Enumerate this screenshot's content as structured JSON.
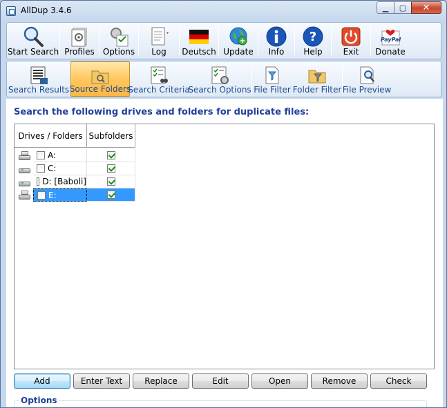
{
  "window": {
    "title": "AllDup 3.4.6",
    "min_glyph": "▁",
    "max_glyph": "▢",
    "close_glyph": "✕"
  },
  "toolbar_main": [
    {
      "label": "Start Search",
      "icon": "magnifier-icon"
    },
    {
      "label": "Profiles",
      "icon": "profiles-icon"
    },
    {
      "label": "Options",
      "icon": "options-icon"
    },
    {
      "label": "Log",
      "icon": "log-icon"
    },
    {
      "label": "Deutsch",
      "icon": "german-flag-icon"
    },
    {
      "label": "Update",
      "icon": "update-globe-icon"
    },
    {
      "label": "Info",
      "icon": "info-icon"
    },
    {
      "label": "Help",
      "icon": "help-icon"
    },
    {
      "label": "Exit",
      "icon": "power-icon"
    },
    {
      "label": "Donate",
      "icon": "paypal-icon"
    }
  ],
  "toolbar_views": [
    {
      "label": "Search Results",
      "active": false
    },
    {
      "label": "Source Folders",
      "active": true
    },
    {
      "label": "Search Criteria",
      "active": false
    },
    {
      "label": "Search Options",
      "active": false
    },
    {
      "label": "File Filter",
      "active": false
    },
    {
      "label": "Folder Filter",
      "active": false
    },
    {
      "label": "File Preview",
      "active": false
    }
  ],
  "main": {
    "heading": "Search the following drives and folders for duplicate files:",
    "columns": [
      "Drives / Folders",
      "Subfolders"
    ],
    "rows": [
      {
        "name": "A:",
        "checked": false,
        "subfolders": true,
        "selected": false
      },
      {
        "name": "C:",
        "checked": false,
        "subfolders": true,
        "selected": false
      },
      {
        "name": "D: [Baboli]",
        "checked": false,
        "subfolders": true,
        "selected": false
      },
      {
        "name": "E:",
        "checked": false,
        "subfolders": true,
        "selected": true
      }
    ],
    "buttons": [
      "Add",
      "Enter Text",
      "Replace",
      "Edit",
      "Open",
      "Remove",
      "Check"
    ],
    "options_label": "Options"
  },
  "colors": {
    "accent": "#1f3f9a",
    "selection": "#3399ff",
    "active_tab": "#ffc760"
  }
}
